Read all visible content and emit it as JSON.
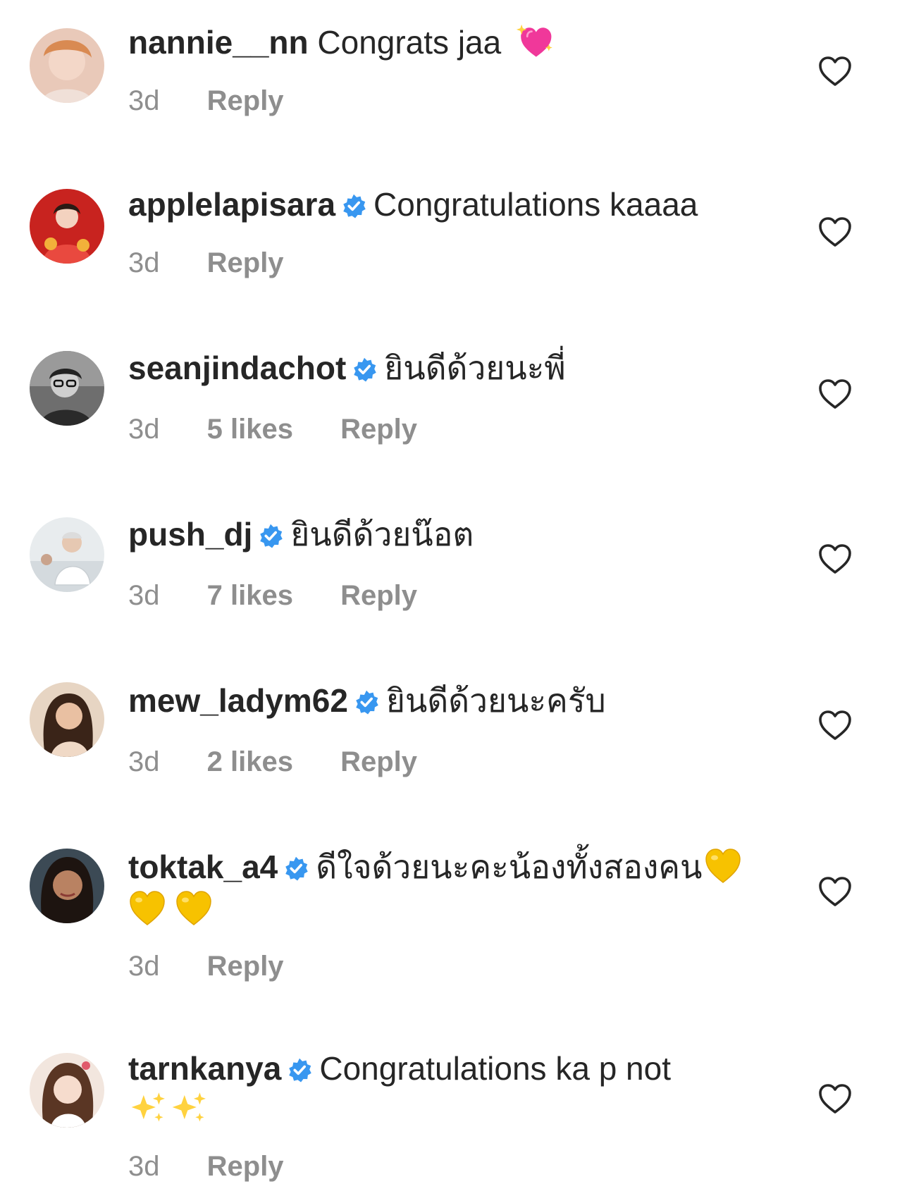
{
  "comments": [
    {
      "username": "nannie__nn",
      "verified": false,
      "text": "Congrats jaa",
      "emoji": "sparkling-heart",
      "time": "3d",
      "likes": "",
      "reply": "Reply"
    },
    {
      "username": "applelapisara",
      "verified": true,
      "text": "Congratulations kaaaa",
      "time": "3d",
      "likes": "",
      "reply": "Reply"
    },
    {
      "username": "seanjindachot",
      "verified": true,
      "text": "ยินดีด้วยนะพี่",
      "time": "3d",
      "likes": "5 likes",
      "reply": "Reply"
    },
    {
      "username": "push_dj",
      "verified": true,
      "text": "ยินดีด้วยน๊อต",
      "time": "3d",
      "likes": "7 likes",
      "reply": "Reply"
    },
    {
      "username": "mew_ladym62",
      "verified": true,
      "text": "ยินดีด้วยนะครับ",
      "time": "3d",
      "likes": "2 likes",
      "reply": "Reply"
    },
    {
      "username": "toktak_a4",
      "verified": true,
      "text": "ดีใจด้วยนะคะน้องทั้งสองคน",
      "emoji": "yellow-heart x3",
      "time": "3d",
      "likes": "",
      "reply": "Reply"
    },
    {
      "username": "tarnkanya",
      "verified": true,
      "text": "Congratulations ka p not",
      "emoji": "sparkles x2",
      "time": "3d",
      "likes": "",
      "reply": "Reply"
    }
  ],
  "colors": {
    "text": "#262626",
    "meta": "#8e8e8e",
    "verified": "#3897f0",
    "heart_outline": "#262626"
  }
}
